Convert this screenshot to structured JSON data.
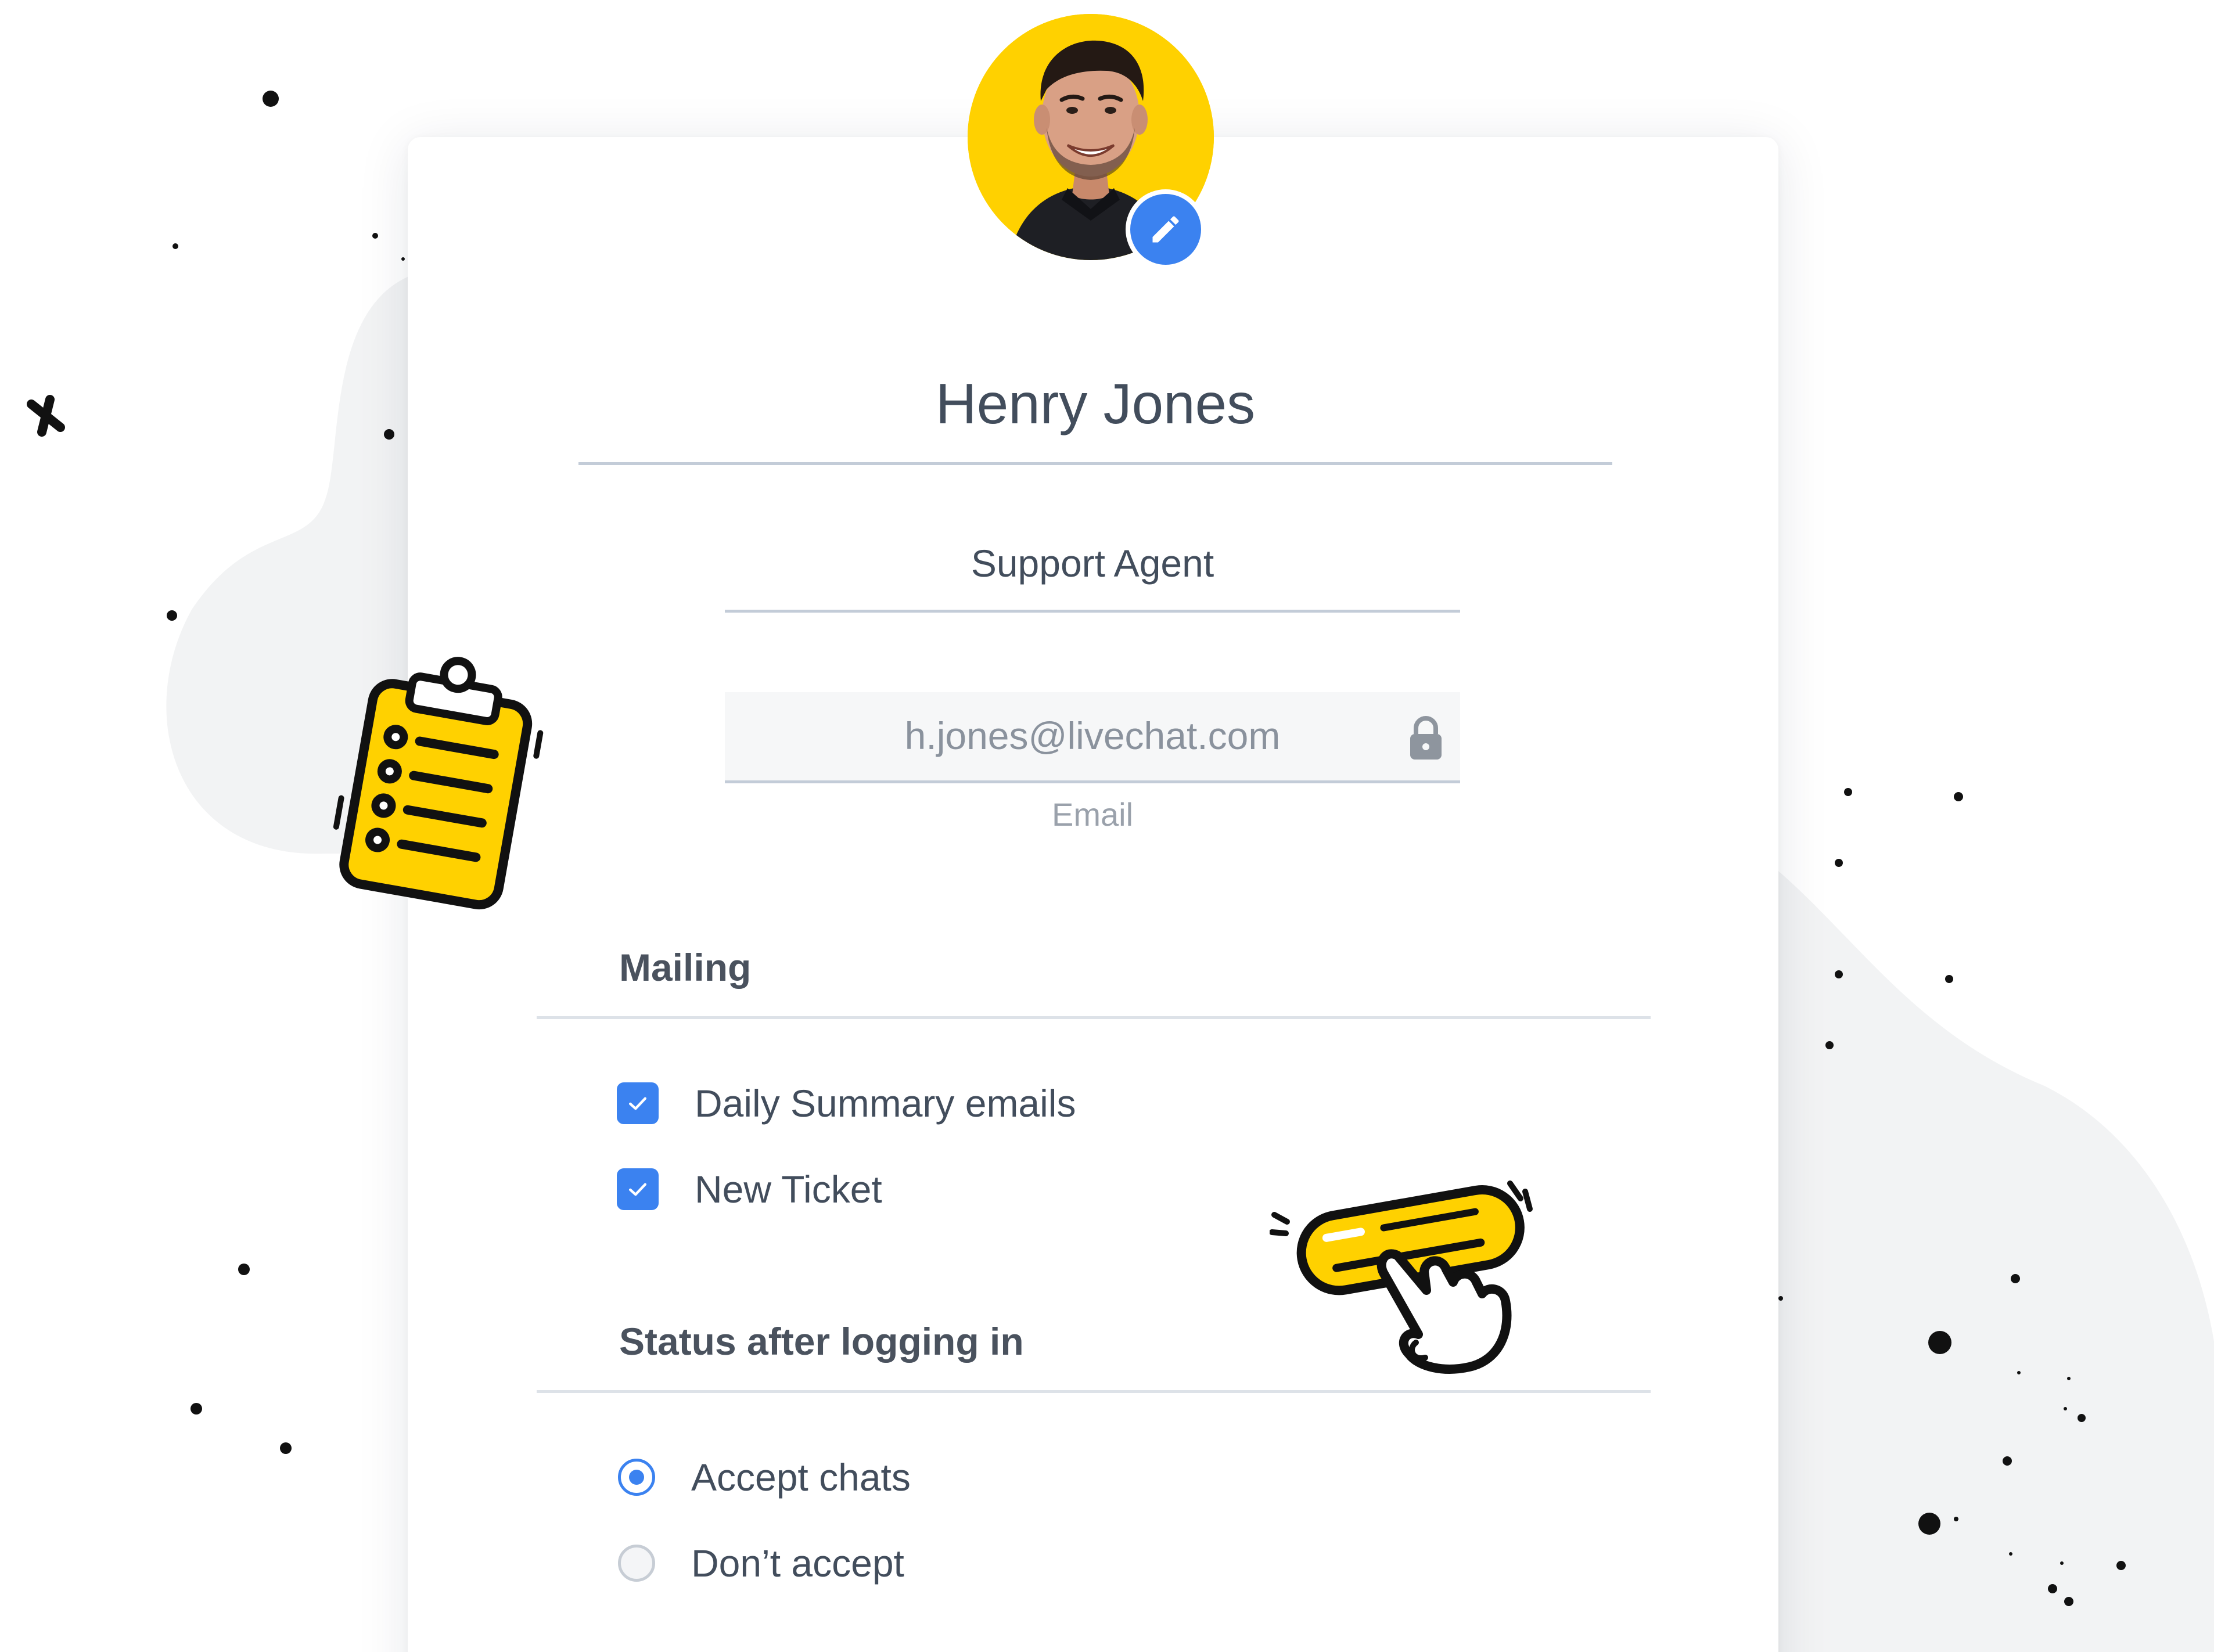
{
  "profile": {
    "name": "Henry Jones",
    "role": "Support Agent",
    "email": "h.jones@livechat.com",
    "email_label": "Email",
    "avatar_bg_color": "#FFD100",
    "edit_icon": "pencil-icon",
    "lock_icon": "lock-icon"
  },
  "mailing": {
    "title": "Mailing",
    "options": [
      {
        "label": "Daily Summary emails",
        "checked": true
      },
      {
        "label": "New Ticket",
        "checked": true
      }
    ]
  },
  "status": {
    "title": "Status after logging in",
    "options": [
      {
        "label": "Accept chats",
        "selected": true
      },
      {
        "label": "Don’t accept",
        "selected": false
      }
    ]
  },
  "colors": {
    "accent": "#3B82F0",
    "highlight": "#FFD100",
    "text": "#424D5C",
    "divider": "#DDE2E8"
  }
}
